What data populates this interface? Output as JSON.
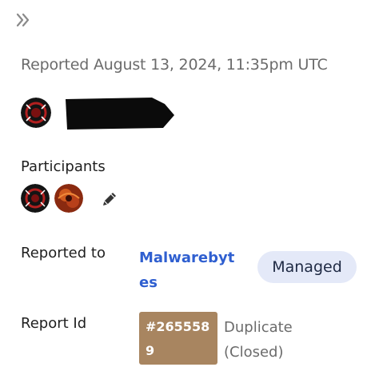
{
  "sidebar": {
    "collapse_icon": "double-chevron-right-icon",
    "reported_text": "Reported August 13, 2024, 11:35pm UTC",
    "reporter": {
      "avatar_icon": "reporter-avatar-icon",
      "name_redacted": true
    },
    "participants": {
      "label": "Participants",
      "avatars": [
        "participant-avatar-icon",
        "participant-avatar-icon"
      ],
      "edit_icon": "pencil-icon"
    },
    "reported_to": {
      "label": "Reported to",
      "program": "Malwarebytes",
      "badge": "Managed"
    },
    "report_id": {
      "label": "Report Id",
      "value": "#2655589",
      "state": "Duplicate (Closed)"
    }
  },
  "colors": {
    "link": "#2f5fd0",
    "managed_badge_bg": "#e4e9f8",
    "report_id_bg": "#a88560",
    "muted_text": "#6b6b6b"
  }
}
